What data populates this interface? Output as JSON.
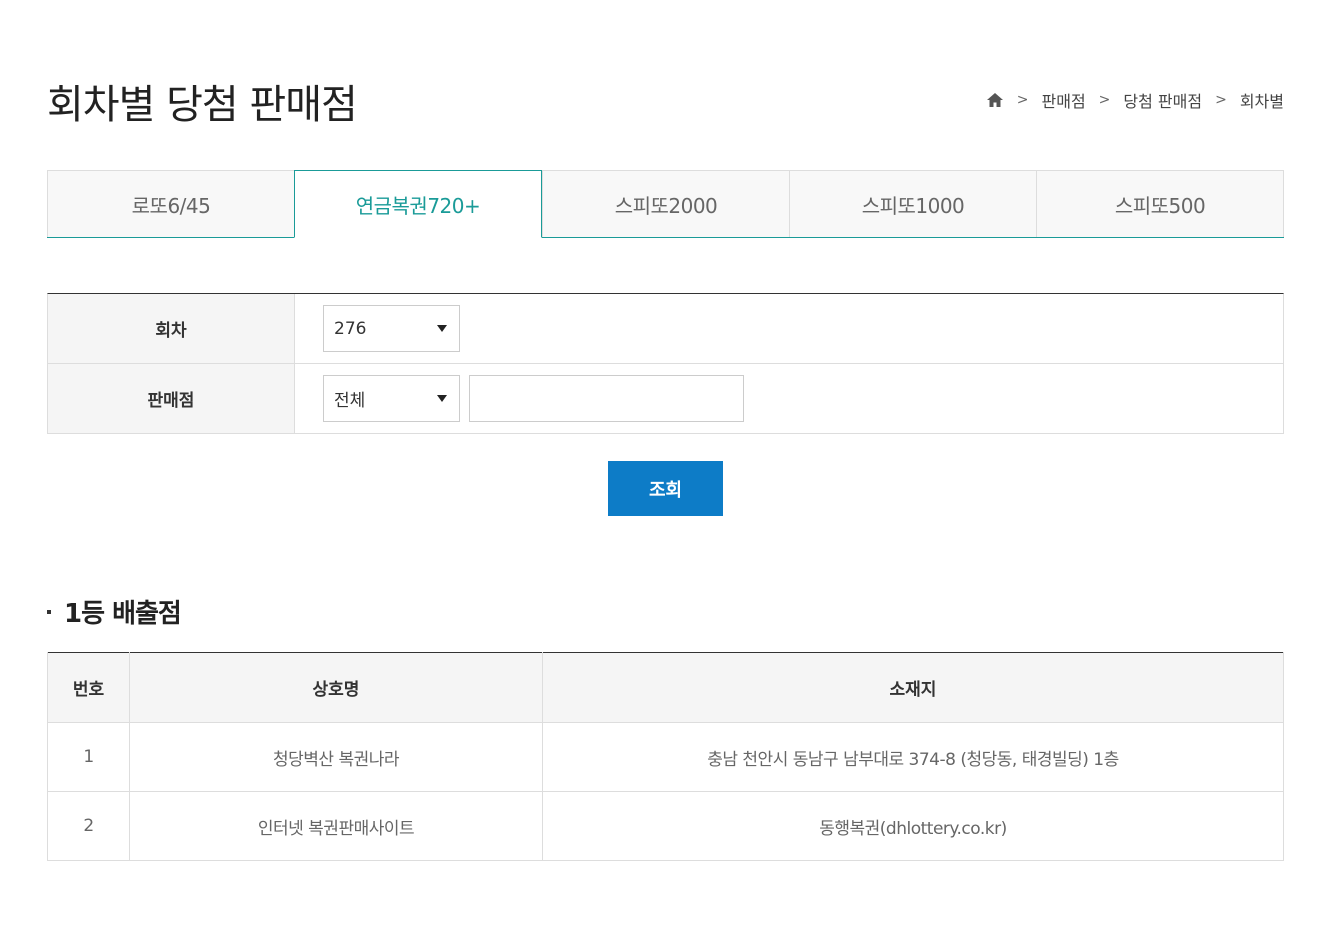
{
  "header": {
    "title": "회차별 당첨 판매점",
    "breadcrumb": [
      "판매점",
      "당첨 판매점",
      "회차별"
    ]
  },
  "tabs": [
    {
      "label": "로또6/45",
      "active": false
    },
    {
      "label": "연금복권720+",
      "active": true
    },
    {
      "label": "스피또2000",
      "active": false
    },
    {
      "label": "스피또1000",
      "active": false
    },
    {
      "label": "스피또500",
      "active": false
    }
  ],
  "search": {
    "round_label": "회차",
    "round_value": "276",
    "store_label": "판매점",
    "store_value": "전체",
    "store_input_value": "",
    "submit_label": "조회"
  },
  "results": {
    "title": "1등 배출점",
    "columns": [
      "번호",
      "상호명",
      "소재지"
    ],
    "rows": [
      {
        "no": "1",
        "name": "청당벽산 복권나라",
        "address": "충남 천안시 동남구 남부대로 374-8 (청당동, 태경빌딩) 1층"
      },
      {
        "no": "2",
        "name": "인터넷 복권판매사이트",
        "address": "동행복권(dhlottery.co.kr)"
      }
    ]
  },
  "colors": {
    "accent_teal": "#1a9b98",
    "button_blue": "#0d7cc7"
  }
}
